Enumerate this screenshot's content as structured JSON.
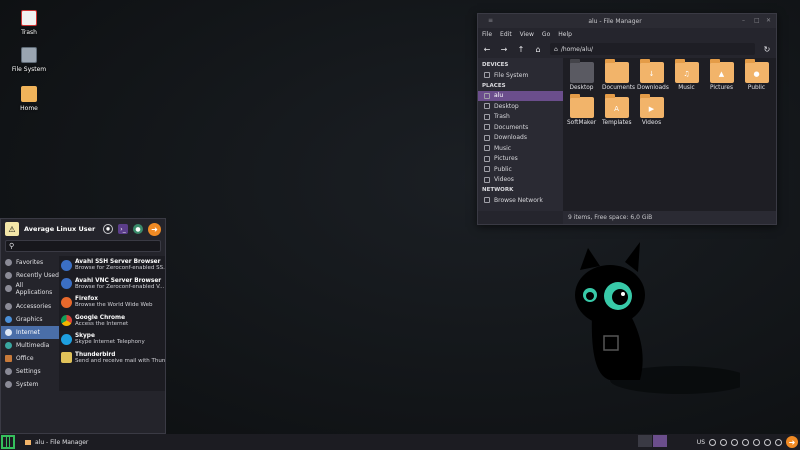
{
  "desktop": {
    "icons": [
      {
        "label": "Trash",
        "icon": "trash-icon"
      },
      {
        "label": "File System",
        "icon": "drive-icon"
      },
      {
        "label": "Home",
        "icon": "home-folder-icon"
      }
    ]
  },
  "file_manager": {
    "title": "alu - File Manager",
    "menu": [
      "File",
      "Edit",
      "View",
      "Go",
      "Help"
    ],
    "path": "/home/alu/",
    "sidebar": {
      "devices_header": "DEVICES",
      "devices": [
        "File System"
      ],
      "places_header": "PLACES",
      "places": [
        "alu",
        "Desktop",
        "Trash",
        "Documents",
        "Downloads",
        "Music",
        "Pictures",
        "Public",
        "Videos"
      ],
      "network_header": "NETWORK",
      "network": [
        "Browse Network"
      ]
    },
    "files": [
      {
        "name": "Desktop",
        "emblem": ""
      },
      {
        "name": "Documents",
        "emblem": ""
      },
      {
        "name": "Downloads",
        "emblem": "↓"
      },
      {
        "name": "Music",
        "emblem": "♫"
      },
      {
        "name": "Pictures",
        "emblem": "▲"
      },
      {
        "name": "Public",
        "emblem": "●"
      },
      {
        "name": "SoftMaker",
        "emblem": ""
      },
      {
        "name": "Templates",
        "emblem": "A"
      },
      {
        "name": "Videos",
        "emblem": "▶"
      }
    ],
    "status": "9 items, Free space: 6,0 GiB"
  },
  "start_menu": {
    "user": "Average Linux User",
    "search_placeholder": "",
    "categories": [
      "Favorites",
      "Recently Used",
      "All Applications",
      "Accessories",
      "Graphics",
      "Internet",
      "Multimedia",
      "Office",
      "Settings",
      "System"
    ],
    "active_category": "Internet",
    "apps": [
      {
        "name": "Avahi SSH Server Browser",
        "desc": "Browse for Zeroconf-enabled SS...",
        "color": "#3b6fc4"
      },
      {
        "name": "Avahi VNC Server Browser",
        "desc": "Browse for Zeroconf-enabled V...",
        "color": "#3b6fc4"
      },
      {
        "name": "Firefox",
        "desc": "Browse the World Wide Web",
        "color": "#e8692c"
      },
      {
        "name": "Google Chrome",
        "desc": "Access the Internet",
        "color": "#3aa757"
      },
      {
        "name": "Skype",
        "desc": "Skype Internet Telephony",
        "color": "#1ea0e0"
      },
      {
        "name": "Thunderbird",
        "desc": "Send and receive mail with Thun...",
        "color": "#e0c25a"
      }
    ]
  },
  "taskbar": {
    "task": "alu - File Manager",
    "keyboard_layout": "US"
  }
}
